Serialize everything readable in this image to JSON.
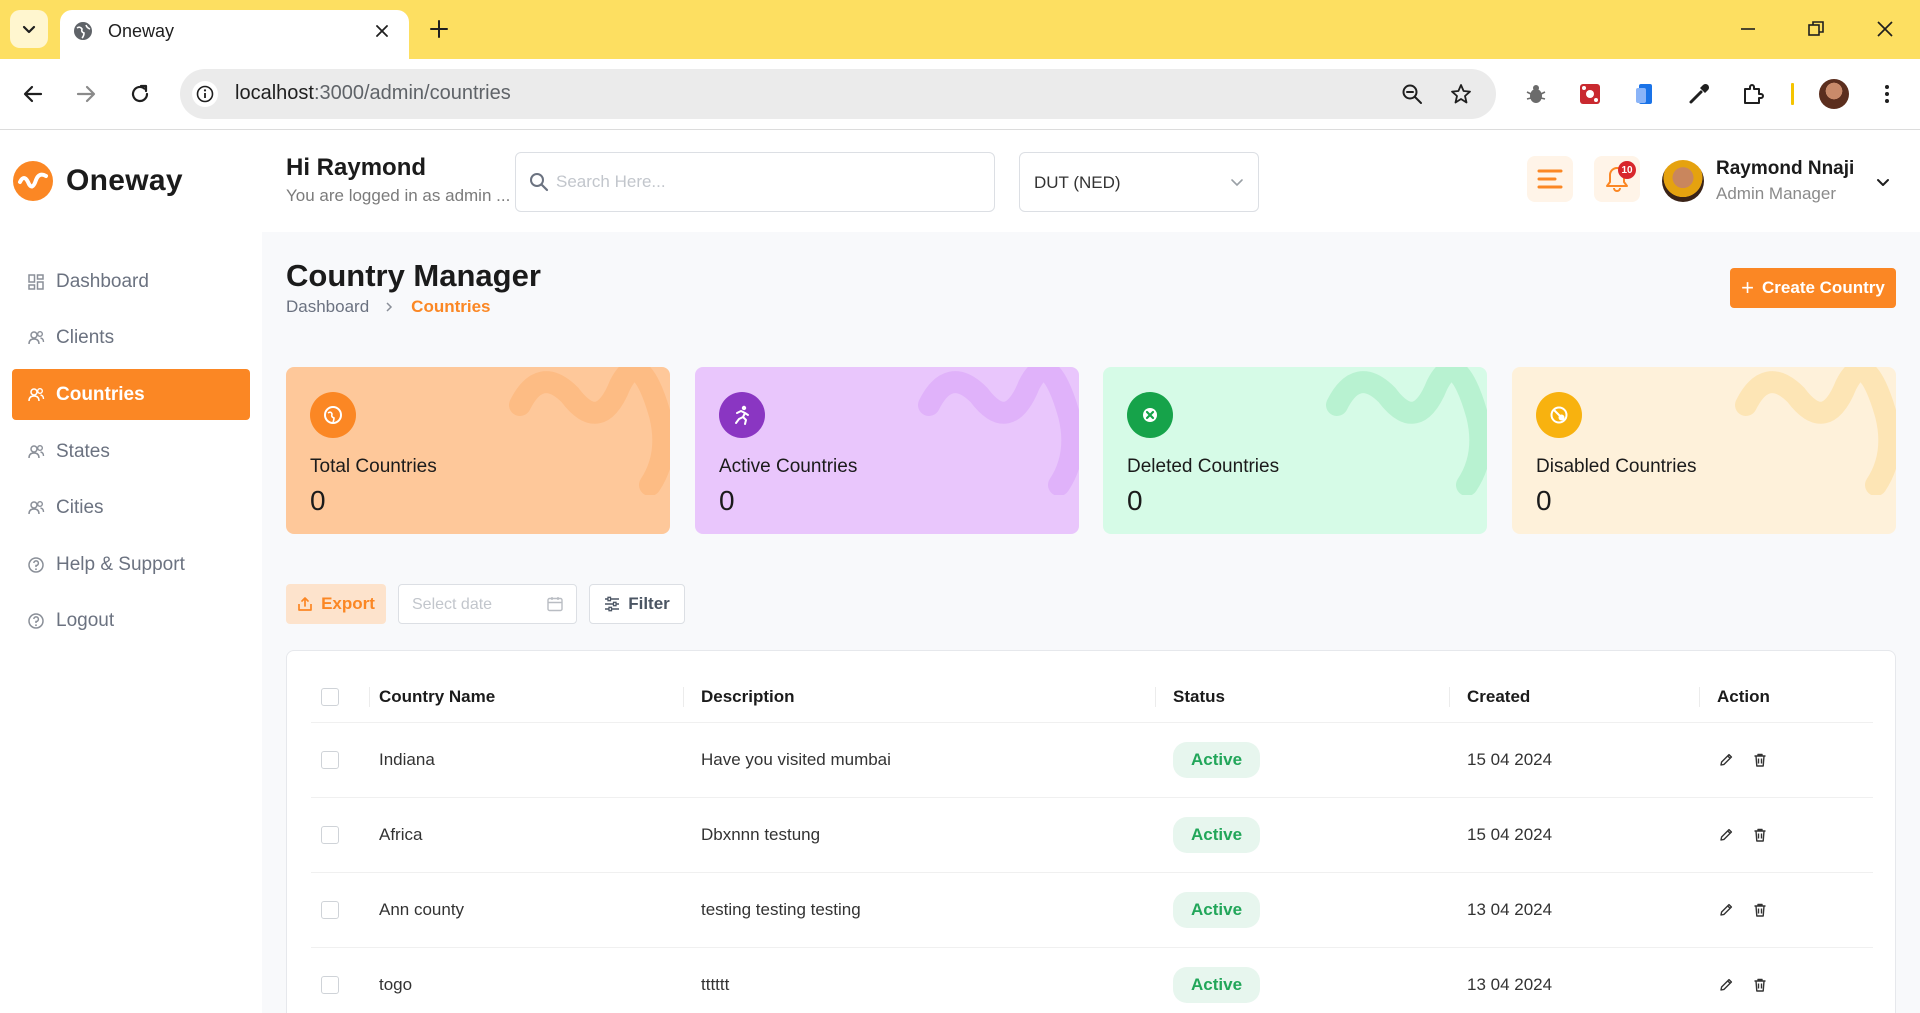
{
  "browser": {
    "tab_title": "Oneway",
    "url_host": "localhost",
    "url_path": ":3000/admin/countries"
  },
  "app": {
    "brand": "Oneway",
    "greeting": "Hi Raymond",
    "greeting_sub": "You are logged in as admin ...",
    "search_placeholder": "Search Here...",
    "currency": "DUT (NED)",
    "notification_count": "10",
    "user_name": "Raymond Nnaji",
    "user_role": "Admin Manager",
    "accent_color": "#fb8724"
  },
  "sidebar": {
    "items": [
      {
        "label": "Dashboard",
        "icon": "grid-icon"
      },
      {
        "label": "Clients",
        "icon": "users-icon"
      },
      {
        "label": "Countries",
        "icon": "users-icon",
        "active": true
      },
      {
        "label": "States",
        "icon": "users-icon"
      },
      {
        "label": "Cities",
        "icon": "users-icon"
      },
      {
        "label": "Help & Support",
        "icon": "help-icon"
      },
      {
        "label": "Logout",
        "icon": "logout-icon"
      }
    ]
  },
  "page": {
    "title": "Country Manager",
    "breadcrumb": [
      "Dashboard",
      "Countries"
    ],
    "create_button": "Create Country"
  },
  "stats": [
    {
      "label": "Total Countries",
      "value": "0",
      "bg": "#fec89a",
      "icon_bg": "#fb8724",
      "icon": "globe-icon"
    },
    {
      "label": "Active Countries",
      "value": "0",
      "bg": "#e9c6fc",
      "icon_bg": "#8a36c2",
      "icon": "running-icon"
    },
    {
      "label": "Deleted Countries",
      "value": "0",
      "bg": "#d6fbe7",
      "icon_bg": "#16a34a",
      "icon": "x-circle-icon"
    },
    {
      "label": "Disabled Countries",
      "value": "0",
      "bg": "#fef1da",
      "icon_bg": "#f8b20f",
      "icon": "disabled-icon"
    }
  ],
  "filters": {
    "export_label": "Export",
    "date_placeholder": "Select date",
    "filter_label": "Filter"
  },
  "table": {
    "columns": [
      "Country Name",
      "Description",
      "Status",
      "Created",
      "Action"
    ],
    "rows": [
      {
        "name": "Indiana",
        "description": "Have you visited mumbai",
        "status": "Active",
        "created": "15 04 2024"
      },
      {
        "name": "Africa",
        "description": "Dbxnnn testung",
        "status": "Active",
        "created": "15 04 2024"
      },
      {
        "name": "Ann county",
        "description": "testing testing testing",
        "status": "Active",
        "created": "13 04 2024"
      },
      {
        "name": "togo",
        "description": "tttttt",
        "status": "Active",
        "created": "13 04 2024"
      }
    ]
  }
}
